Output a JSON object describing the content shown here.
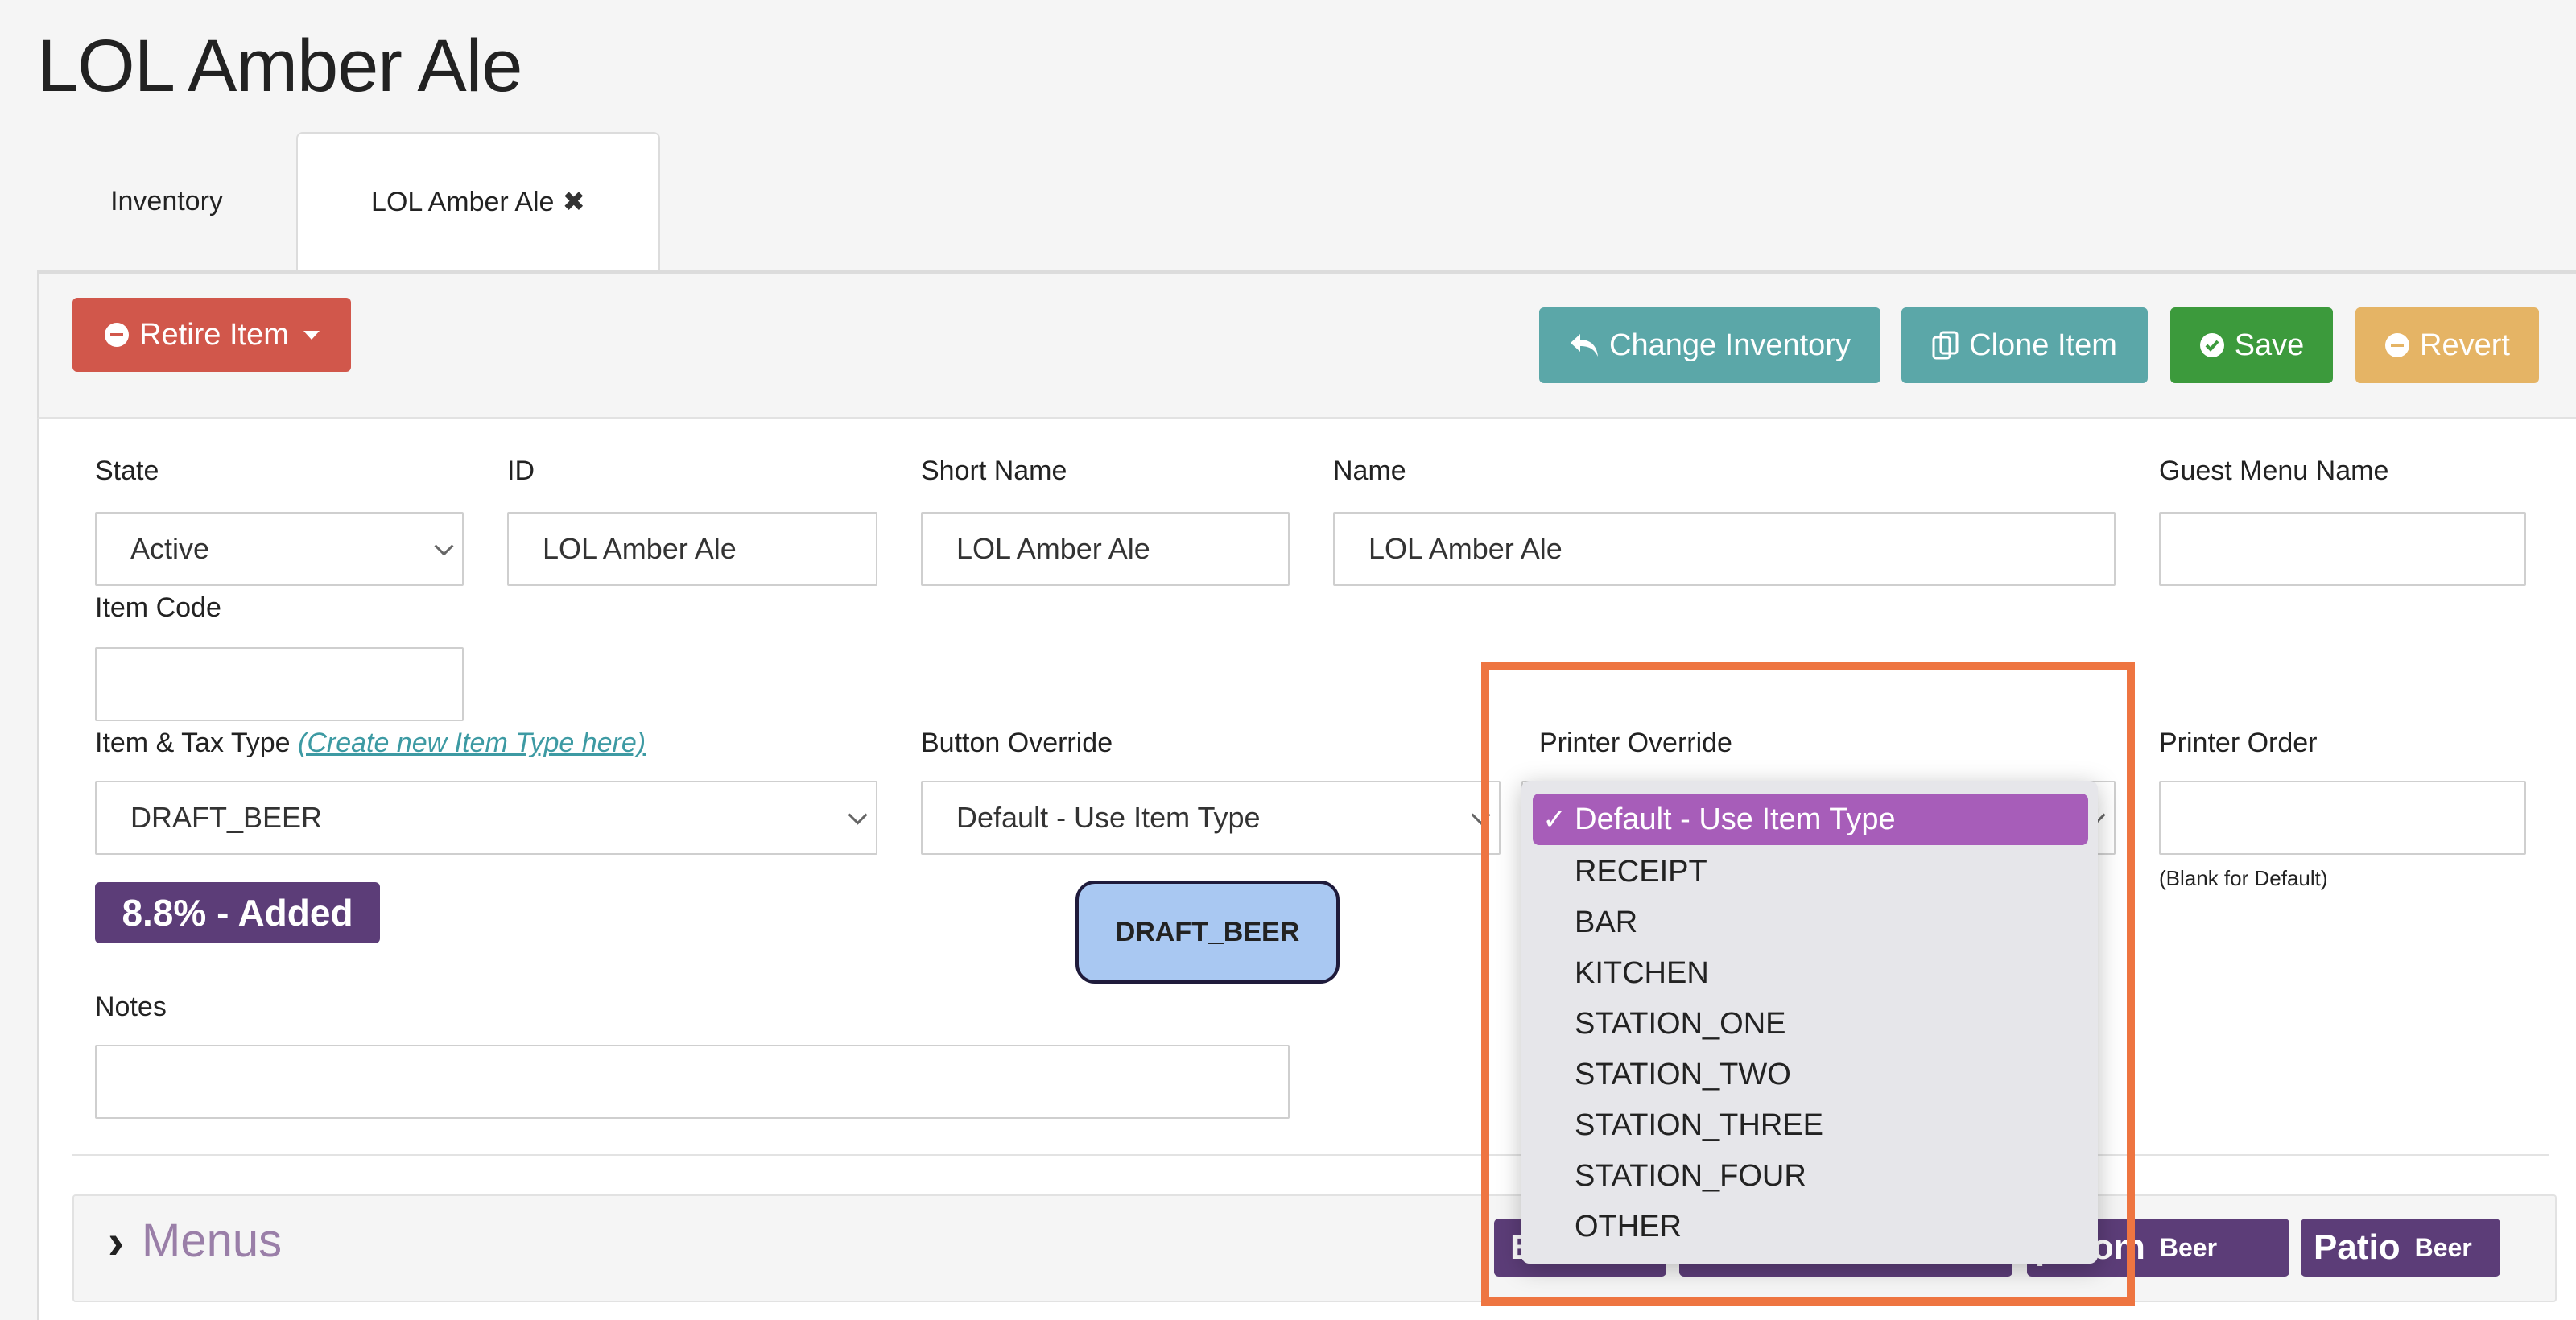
{
  "page": {
    "title": "LOL Amber Ale"
  },
  "tabs": [
    {
      "label": "Inventory"
    },
    {
      "label": "LOL Amber Ale"
    }
  ],
  "toolbar": {
    "retire_label": "Retire Item",
    "change_inventory_label": "Change Inventory",
    "clone_label": "Clone Item",
    "save_label": "Save",
    "revert_label": "Revert"
  },
  "form": {
    "state": {
      "label": "State",
      "value": "Active"
    },
    "id": {
      "label": "ID",
      "value": "LOL Amber Ale"
    },
    "short_name": {
      "label": "Short Name",
      "value": "LOL Amber Ale"
    },
    "name": {
      "label": "Name",
      "value": "LOL Amber Ale"
    },
    "guest_menu_name": {
      "label": "Guest Menu Name",
      "value": ""
    },
    "item_code": {
      "label": "Item Code",
      "value": ""
    },
    "item_tax_type": {
      "label": "Item & Tax Type",
      "link": "(Create new Item Type here)",
      "value": "DRAFT_BEER"
    },
    "tax_badge": "8.8% - Added",
    "button_override": {
      "label": "Button Override",
      "value": "Default - Use Item Type"
    },
    "button_preview": "DRAFT_BEER",
    "printer_override": {
      "label": "Printer Override",
      "selected": "Default - Use Item Type",
      "options": [
        "RECEIPT",
        "BAR",
        "KITCHEN",
        "STATION_ONE",
        "STATION_TWO",
        "STATION_THREE",
        "STATION_FOUR",
        "OTHER"
      ]
    },
    "printer_order": {
      "label": "Printer Order",
      "value": "",
      "hint": "(Blank for Default)"
    },
    "notes": {
      "label": "Notes",
      "value": ""
    }
  },
  "menus": {
    "title": "Menus",
    "chips": [
      {
        "main": "E",
        "sub": ""
      },
      {
        "main": "",
        "sub": ""
      },
      {
        "main": "proom",
        "sub": "Beer"
      },
      {
        "main": "Patio",
        "sub": "Beer"
      }
    ]
  },
  "colors": {
    "retire": "#d1574b",
    "teal": "#5ba7a8",
    "save": "#3c9a3c",
    "revert": "#e5b465",
    "badge_purple": "#5c3d78",
    "dropdown_highlight": "#a75db9",
    "annotation_box": "#ee7541"
  }
}
